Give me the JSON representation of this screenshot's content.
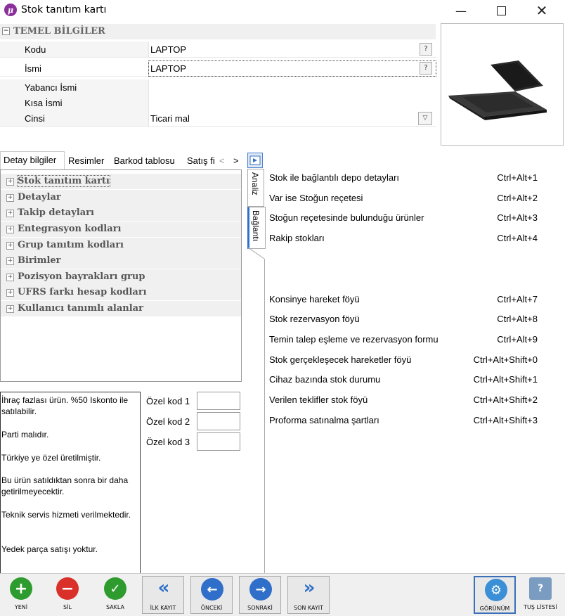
{
  "window": {
    "title": "Stok tanıtım kartı",
    "icon": "app-logo-icon"
  },
  "property_grid": {
    "group": "TEMEL BİLGİLER",
    "rows": [
      {
        "label": "Kodu",
        "value": "LAPTOP"
      },
      {
        "label": "İsmi",
        "value": "LAPTOP"
      },
      {
        "label": "Yabancı İsmi",
        "value": ""
      },
      {
        "label": "Kısa İsmi",
        "value": ""
      },
      {
        "label": "Cinsi",
        "value": "Ticari mal"
      }
    ],
    "help_button": "?"
  },
  "tabs": [
    "Detay bilgiler",
    "Resimler",
    "Barkod tablosu",
    "Satış fi"
  ],
  "tree": [
    "Stok tanıtım kartı",
    "Detaylar",
    "Takip detayları",
    "Entegrasyon kodları",
    "Grup tanıtım kodları",
    "Birimler",
    "Pozisyon bayrakları grup",
    "UFRS farkı hesap kodları",
    "Kullanıcı tanımlı alanlar"
  ],
  "side_tabs": [
    "Analiz",
    "Bağlantı"
  ],
  "notes": [
    "İhraç fazlası ürün. %50 Iskonto ile satılabilir.",
    "Parti malıdır.",
    "Türkiye ye özel üretilmiştir.",
    "Bu ürün satıldıktan sonra bir daha getirilmeyecektir.",
    "Teknik servis hizmeti verilmektedir.",
    "Yedek parça satışı yoktur."
  ],
  "special_codes": [
    {
      "label": "Özel kod 1",
      "value": ""
    },
    {
      "label": "Özel kod 2",
      "value": ""
    },
    {
      "label": "Özel kod 3",
      "value": ""
    }
  ],
  "shortcuts": [
    {
      "name": "Stok ile bağlantılı depo detayları",
      "key": "Ctrl+Alt+1"
    },
    {
      "name": "Var ise Stoğun reçetesi",
      "key": "Ctrl+Alt+2"
    },
    {
      "name": "Stoğun reçetesinde bulunduğu ürünler",
      "key": "Ctrl+Alt+3"
    },
    {
      "name": "Rakip stokları",
      "key": "Ctrl+Alt+4"
    },
    {
      "name": "Konsinye hareket föyü",
      "key": "Ctrl+Alt+7"
    },
    {
      "name": "Stok rezervasyon föyü",
      "key": "Ctrl+Alt+8"
    },
    {
      "name": "Temin talep eşleme ve rezervasyon formu",
      "key": "Ctrl+Alt+9"
    },
    {
      "name": "Stok gerçekleşecek hareketler föyü",
      "key": "Ctrl+Alt+Shift+0"
    },
    {
      "name": "Cihaz bazında stok durumu",
      "key": "Ctrl+Alt+Shift+1"
    },
    {
      "name": "Verilen teklifler stok föyü",
      "key": "Ctrl+Alt+Shift+2"
    },
    {
      "name": "Proforma satınalma şartları",
      "key": "Ctrl+Alt+Shift+3"
    }
  ],
  "toolbar": {
    "new": "YENİ",
    "delete": "SİL",
    "save": "SAKLA",
    "first": "İLK KAYIT",
    "prev": "ÖNCEKİ",
    "next": "SONRAKİ",
    "last": "SON KAYIT",
    "view": "GÖRÜNÜM",
    "keys": "TUŞ LİSTESİ"
  },
  "colors": {
    "green": "#2e9b2e",
    "red": "#d9302a",
    "blue": "#2f6fc9",
    "accent": "#8b2f9a"
  }
}
